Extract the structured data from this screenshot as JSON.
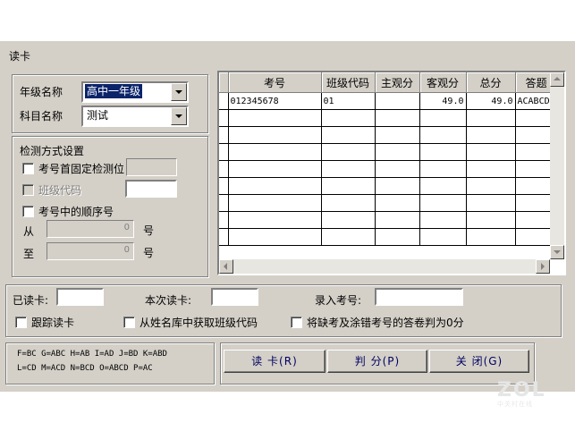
{
  "window": {
    "title": "读卡"
  },
  "grade": {
    "label": "年级名称",
    "value": "高中一年级"
  },
  "subject": {
    "label": "科目名称",
    "value": "测试"
  },
  "detect": {
    "title": "检测方式设置",
    "opt1": "考号首固定检测位",
    "opt2": "班级代码",
    "opt3": "考号中的顺序号",
    "from_label": "从",
    "to_label": "至",
    "from_value": "0",
    "to_value": "0",
    "unit1": "号",
    "unit2": "号"
  },
  "table": {
    "headers": [
      "考号",
      "班级代码",
      "主观分",
      "客观分",
      "总分",
      "答题"
    ],
    "rows": [
      [
        "012345678",
        "01",
        "",
        "49.0",
        "49.0",
        "ACABCDC"
      ]
    ]
  },
  "status": {
    "read_label": "已读卡:",
    "this_label": "本次读卡:",
    "entry_label": "录入考号:",
    "follow": "跟踪读卡",
    "from_db": "从姓名库中获取班级代码",
    "missing_zero": "将缺考及涂错考号的答卷判为0分"
  },
  "codes": {
    "line1": "F=BC G=ABC H=AB I=AD J=BD K=ABD",
    "line2": "L=CD M=ACD N=BCD O=ABCD P=AC"
  },
  "buttons": {
    "read": "读  卡(R)",
    "score": "判  分(P)",
    "close": "关  闭(G)"
  },
  "watermark": {
    "brand": "ZOL",
    "sub": "中关村在线"
  }
}
